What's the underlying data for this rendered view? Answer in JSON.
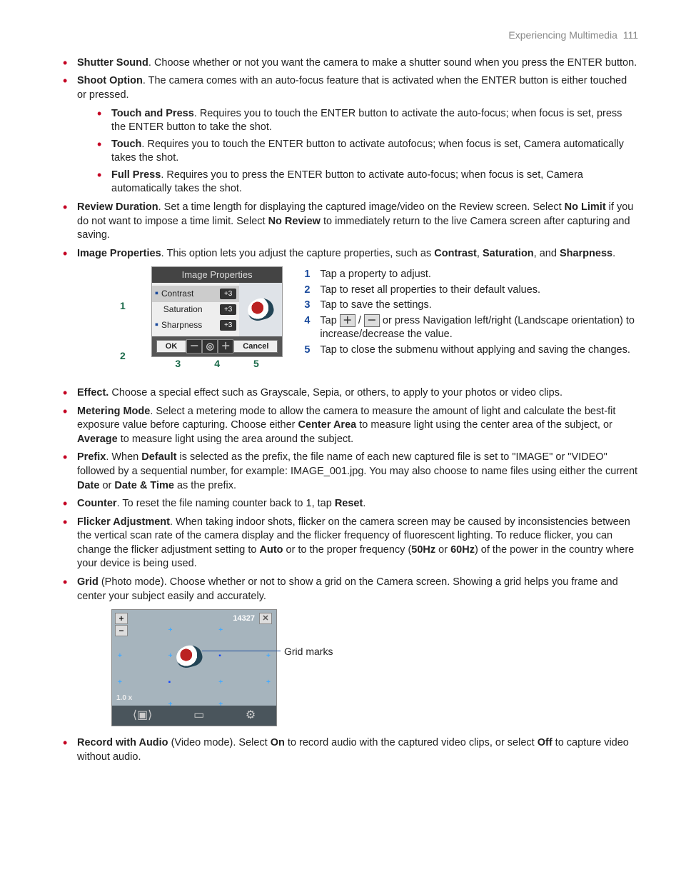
{
  "header": {
    "section": "Experiencing Multimedia",
    "page": "111"
  },
  "items": {
    "shutter": {
      "title": "Shutter Sound",
      "text": ". Choose whether or not you want the camera to make a shutter sound when you press the ENTER button."
    },
    "shoot": {
      "title": "Shoot Option",
      "text": ". The camera comes with an auto-focus feature that is activated when the ENTER button is either touched or pressed.",
      "sub": {
        "tp": {
          "title": "Touch and Press",
          "text": ". Requires you to touch the ENTER button to activate the auto-focus; when focus is set, press the ENTER button to take the shot."
        },
        "t": {
          "title": "Touch",
          "text": ". Requires you to touch the ENTER button to activate autofocus; when focus is set, Camera automatically takes the shot."
        },
        "fp": {
          "title": "Full Press",
          "text": ". Requires you to press the ENTER button to activate auto-focus; when focus is set, Camera automatically takes the shot."
        }
      }
    },
    "review": {
      "title": "Review Duration",
      "t1": ". Set a time length for displaying the captured image/video on the Review screen. Select ",
      "b1": "No Limit",
      "t2": " if you do not want to impose a time limit. Select ",
      "b2": "No Review",
      "t3": " to immediately return to the live Camera screen after capturing and saving."
    },
    "imgprops": {
      "title": "Image Properties",
      "t1": ". This option lets you adjust the capture properties, such as ",
      "b1": "Contrast",
      "sep1": ", ",
      "b2": "Saturation",
      "t2": ", and ",
      "b3": "Sharpness",
      "t3": "."
    },
    "effect": {
      "title": "Effect.",
      "text": " Choose a special effect such as Grayscale, Sepia, or others, to apply to your photos or video clips."
    },
    "metering": {
      "title": "Metering Mode",
      "t1": ". Select a metering mode to allow the camera to measure the amount of light and calculate the best-fit exposure value before capturing. Choose either ",
      "b1": "Center Area",
      "t2": " to measure light using the center area of the subject, or ",
      "b2": "Average",
      "t3": " to measure light using the area around the subject."
    },
    "prefix": {
      "title": "Prefix",
      "t1": ". When ",
      "b1": "Default",
      "t2": " is selected as the prefix, the file name of each new captured file is set to \"IMAGE\" or \"VIDEO\" followed by a sequential number, for example: IMAGE_001.jpg. You may also choose to name files using either the current ",
      "b2": "Date",
      "t3": " or ",
      "b3": "Date & Time",
      "t4": " as the prefix."
    },
    "counter": {
      "title": "Counter",
      "t1": ". To reset the file naming counter back to 1, tap ",
      "b1": "Reset",
      "t2": "."
    },
    "flicker": {
      "title": "Flicker Adjustment",
      "t1": ". When taking indoor shots, flicker on the camera screen may be caused by inconsistencies between the vertical scan rate of the camera display and the flicker frequency of fluorescent lighting. To reduce flicker, you can change the flicker adjustment setting to ",
      "b1": "Auto",
      "t2": " or to the proper frequency (",
      "b2": "50Hz",
      "t3": " or ",
      "b3": "60Hz",
      "t4": ") of the power in the country where your device is being used."
    },
    "grid": {
      "title": "Grid",
      "text": " (Photo mode). Choose whether or not to show a grid on the Camera screen. Showing a grid helps you frame and center your subject easily and accurately."
    },
    "record": {
      "title": "Record with Audio",
      "t1": " (Video mode). Select ",
      "b1": "On",
      "t2": " to record audio with the captured video clips, or select ",
      "b2": "Off",
      "t3": " to capture video without audio."
    }
  },
  "ip_figure": {
    "title": "Image Properties",
    "rows": {
      "contrast": {
        "label": "Contrast",
        "value": "+3"
      },
      "saturation": {
        "label": "Saturation",
        "value": "+3"
      },
      "sharpness": {
        "label": "Sharpness",
        "value": "+3"
      }
    },
    "ok": "OK",
    "cancel": "Cancel",
    "left_callouts": {
      "n1": "1",
      "n2": "2"
    },
    "bottom_callouts": {
      "n3": "3",
      "n4": "4",
      "n5": "5"
    }
  },
  "ip_notes": {
    "n1": {
      "num": "1",
      "text": "Tap a property to adjust."
    },
    "n2": {
      "num": "2",
      "text": "Tap to reset all properties to their default values."
    },
    "n3": {
      "num": "3",
      "text": "Tap to save the settings."
    },
    "n4": {
      "num": "4",
      "t1": "Tap ",
      "plus": "＋",
      "slash": " / ",
      "minus": "－",
      "t2": " or press Navigation left/right (Landscape orientation) to increase/decrease the value."
    },
    "n5": {
      "num": "5",
      "text": "Tap to close the submenu without applying and saving the changes."
    }
  },
  "grid_figure": {
    "count": "14327",
    "zoom": "1.0 x",
    "label": "Grid marks"
  }
}
